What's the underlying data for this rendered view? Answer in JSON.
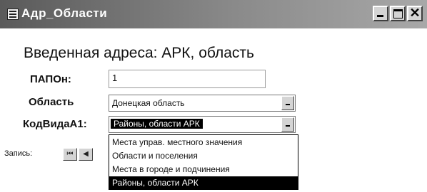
{
  "window": {
    "title": "Адр_Области",
    "minimize_icon": "minimize-icon",
    "maximize_icon": "maximize-icon",
    "close_glyph": "✕"
  },
  "form": {
    "heading": "Введенная адреса: АРК, область",
    "fields": {
      "id_label": "ПАПОн:",
      "id_value": "1",
      "region_label": "Область",
      "region_value": "Донецкая область",
      "code_label": "КодВидаА1:",
      "code_value": "Районы, области АРК"
    },
    "dropdown_options": [
      "Места управ. местного значения",
      "Области и поселения",
      "Места в городе и подчинения",
      "Районы, области АРК"
    ],
    "selected_option_index": 3
  },
  "navigator": {
    "label": "Запись:",
    "first_glyph": "⏮",
    "prev_glyph": "◀"
  }
}
